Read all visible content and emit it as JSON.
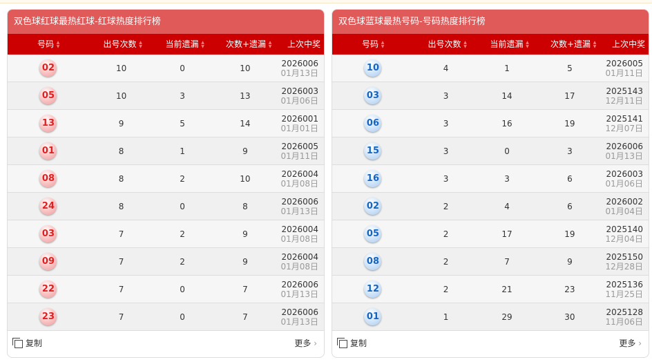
{
  "columns": [
    "号码",
    "出号次数",
    "当前遗漏",
    "次数+遗漏",
    "上次中奖"
  ],
  "copy_label": "复制",
  "more_label": "更多",
  "red": {
    "title": "双色球红球最热红球-红球热度排行榜",
    "rows": [
      [
        "02",
        "10",
        "0",
        "10",
        "2026006",
        "01月13日"
      ],
      [
        "05",
        "10",
        "3",
        "13",
        "2026003",
        "01月06日"
      ],
      [
        "13",
        "9",
        "5",
        "14",
        "2026001",
        "01月01日"
      ],
      [
        "01",
        "8",
        "1",
        "9",
        "2026005",
        "01月11日"
      ],
      [
        "08",
        "8",
        "2",
        "10",
        "2026004",
        "01月08日"
      ],
      [
        "24",
        "8",
        "0",
        "8",
        "2026006",
        "01月13日"
      ],
      [
        "03",
        "7",
        "2",
        "9",
        "2026004",
        "01月08日"
      ],
      [
        "09",
        "7",
        "2",
        "9",
        "2026004",
        "01月08日"
      ],
      [
        "22",
        "7",
        "0",
        "7",
        "2026006",
        "01月13日"
      ],
      [
        "23",
        "7",
        "0",
        "7",
        "2026006",
        "01月13日"
      ]
    ]
  },
  "blue": {
    "title": "双色球蓝球最热号码-号码热度排行榜",
    "rows": [
      [
        "10",
        "4",
        "1",
        "5",
        "2026005",
        "01月11日"
      ],
      [
        "03",
        "3",
        "14",
        "17",
        "2025143",
        "12月11日"
      ],
      [
        "06",
        "3",
        "16",
        "19",
        "2025141",
        "12月07日"
      ],
      [
        "15",
        "3",
        "0",
        "3",
        "2026006",
        "01月13日"
      ],
      [
        "16",
        "3",
        "3",
        "6",
        "2026003",
        "01月06日"
      ],
      [
        "02",
        "2",
        "4",
        "6",
        "2026002",
        "01月04日"
      ],
      [
        "05",
        "2",
        "17",
        "19",
        "2025140",
        "12月04日"
      ],
      [
        "08",
        "2",
        "7",
        "9",
        "2025150",
        "12月28日"
      ],
      [
        "12",
        "2",
        "21",
        "23",
        "2025136",
        "11月25日"
      ],
      [
        "01",
        "1",
        "29",
        "30",
        "2025128",
        "11月06日"
      ]
    ]
  }
}
